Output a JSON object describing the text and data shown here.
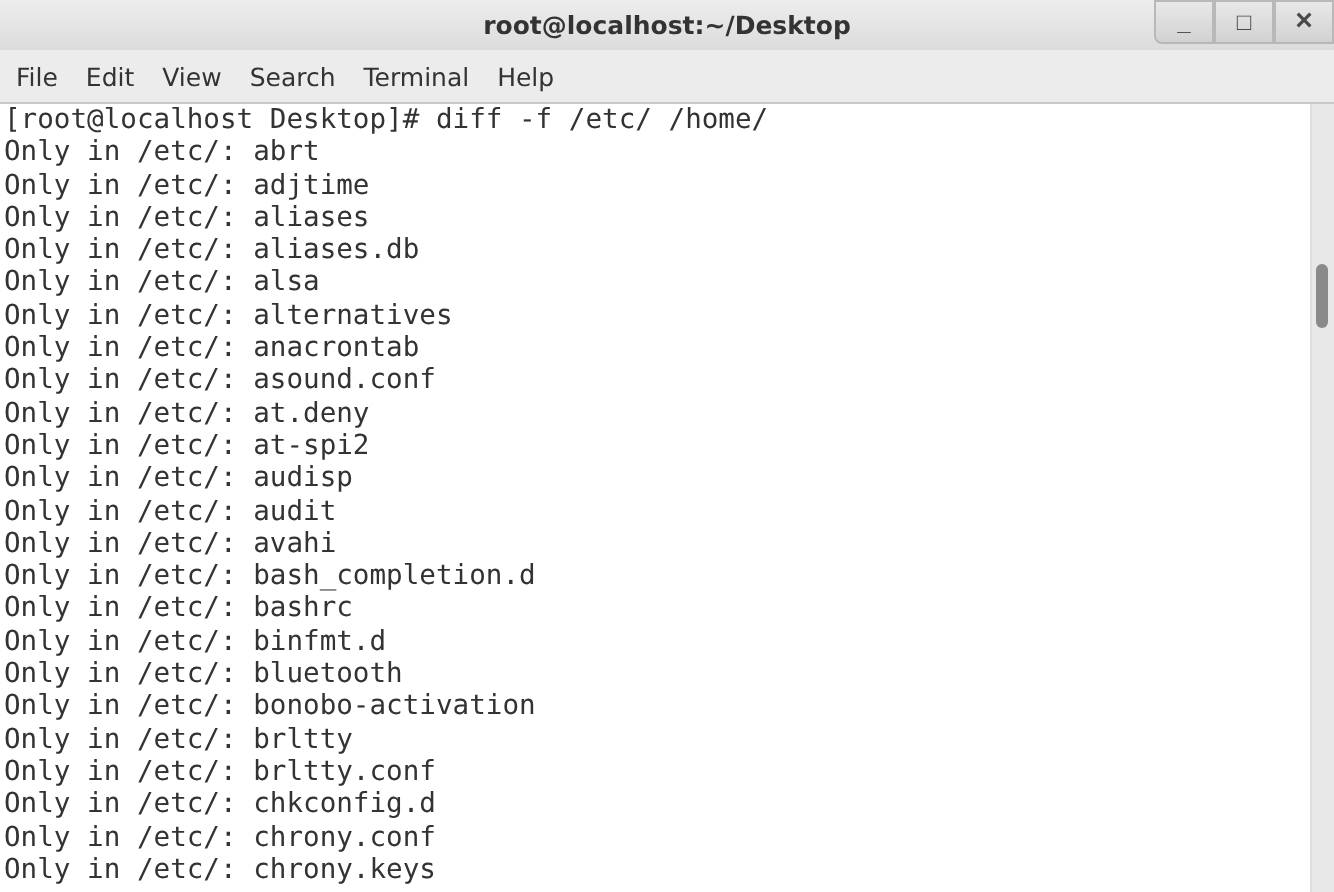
{
  "window": {
    "title": "root@localhost:~/Desktop",
    "controls": [
      {
        "kind": "minimize",
        "label": "_"
      },
      {
        "kind": "maximize",
        "label": "□"
      },
      {
        "kind": "close",
        "label": "×"
      }
    ]
  },
  "menu": [
    "File",
    "Edit",
    "View",
    "Search",
    "Terminal",
    "Help"
  ],
  "terminal": {
    "lines": [
      "[root@localhost Desktop]# diff -f /etc/ /home/",
      "Only in /etc/: abrt",
      "Only in /etc/: adjtime",
      "Only in /etc/: aliases",
      "Only in /etc/: aliases.db",
      "Only in /etc/: alsa",
      "Only in /etc/: alternatives",
      "Only in /etc/: anacrontab",
      "Only in /etc/: asound.conf",
      "Only in /etc/: at.deny",
      "Only in /etc/: at-spi2",
      "Only in /etc/: audisp",
      "Only in /etc/: audit",
      "Only in /etc/: avahi",
      "Only in /etc/: bash_completion.d",
      "Only in /etc/: bashrc",
      "Only in /etc/: binfmt.d",
      "Only in /etc/: bluetooth",
      "Only in /etc/: bonobo-activation",
      "Only in /etc/: brltty",
      "Only in /etc/: brltty.conf",
      "Only in /etc/: chkconfig.d",
      "Only in /etc/: chrony.conf",
      "Only in /etc/: chrony.keys"
    ]
  }
}
